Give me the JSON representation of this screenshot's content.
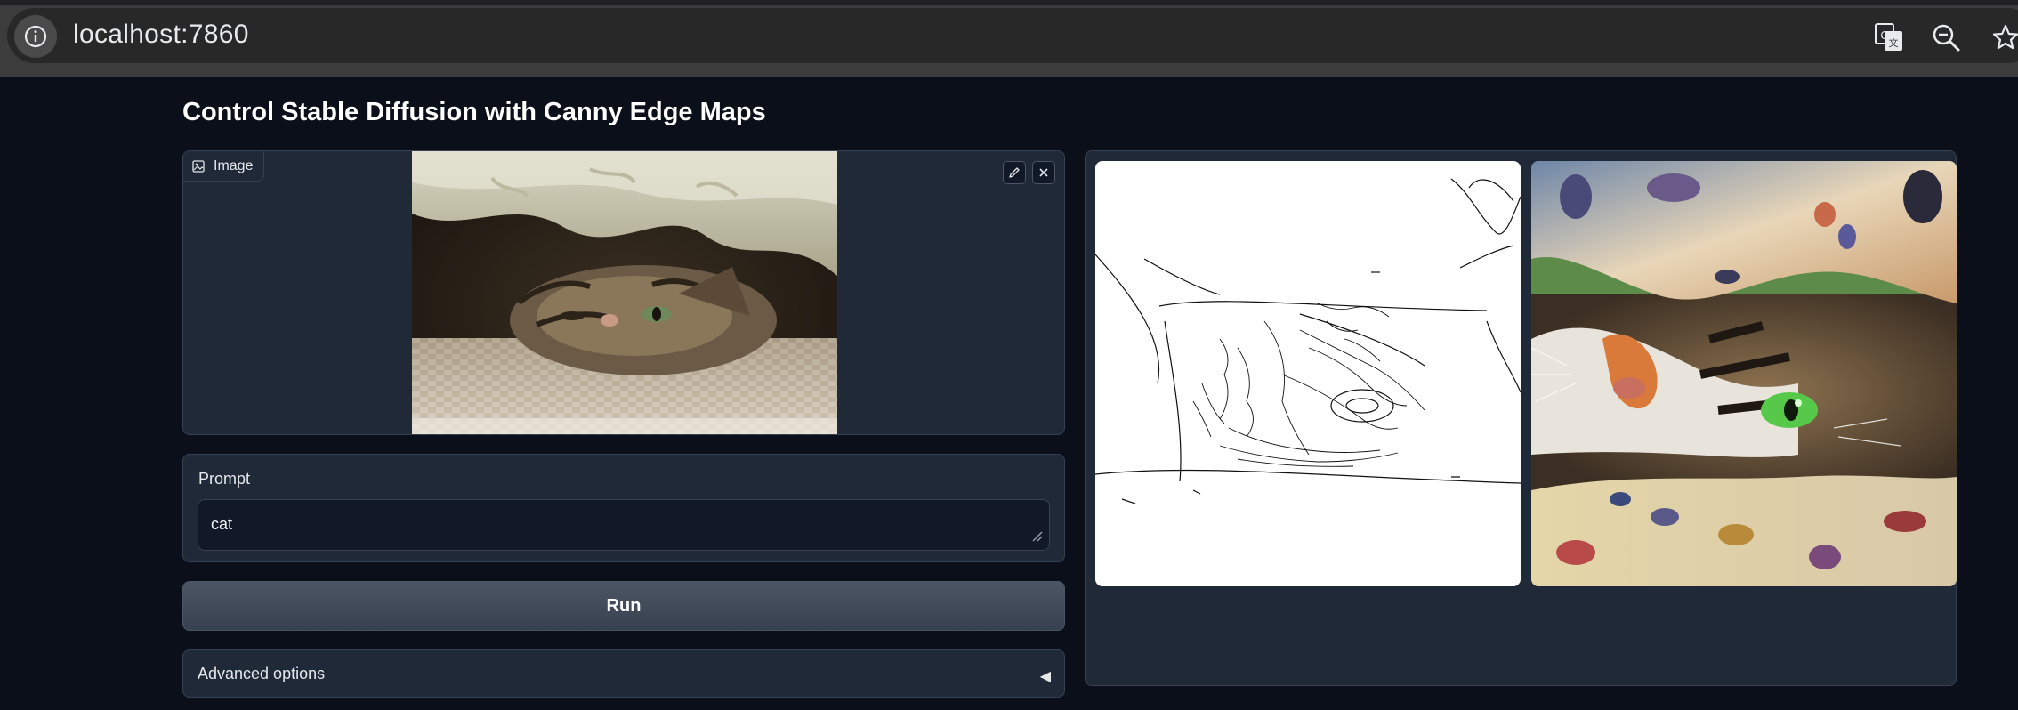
{
  "browser": {
    "url": "localhost:7860",
    "icons": [
      "info-icon",
      "translate-icon",
      "zoom-out-icon",
      "bookmark-star-icon"
    ]
  },
  "app": {
    "title": "Control Stable Diffusion with Canny Edge Maps"
  },
  "image_input": {
    "label": "Image",
    "icons": [
      "image-icon",
      "edit-icon",
      "close-icon"
    ]
  },
  "prompt": {
    "label": "Prompt",
    "value": "cat"
  },
  "run_button": {
    "label": "Run"
  },
  "advanced": {
    "label": "Advanced options",
    "arrow": "◀"
  },
  "gallery": {
    "items": [
      "canny-edge-map",
      "generated-cat-image"
    ]
  },
  "colors": {
    "background": "#0b0f19",
    "panel": "#1f2937",
    "border": "#374151",
    "button": "#4b5563"
  }
}
